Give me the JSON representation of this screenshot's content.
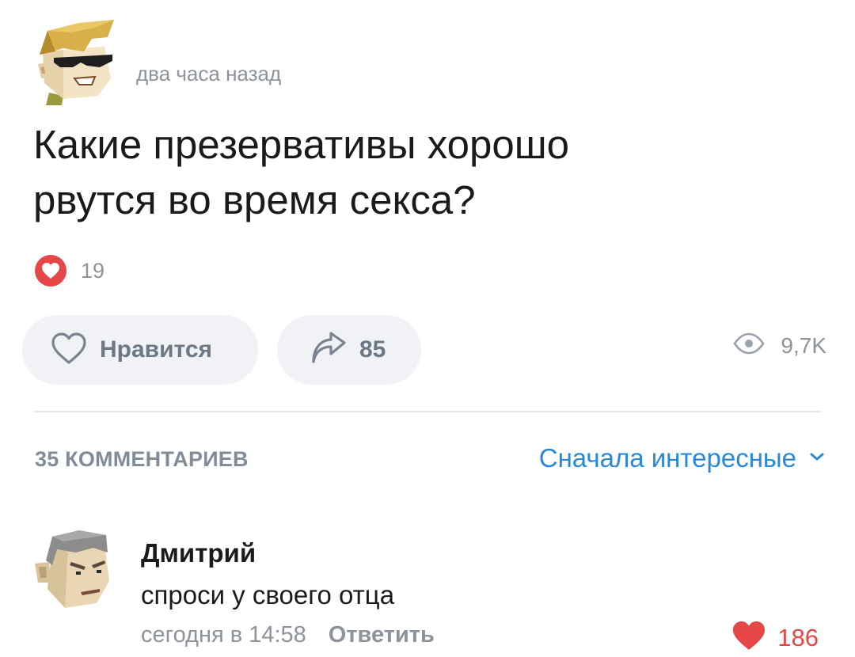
{
  "post": {
    "time": "два часа назад",
    "text_line1": "Какие презервативы хорошо",
    "text_line2": "рвутся во время секса?",
    "reaction_count": "19",
    "like_label": "Нравится",
    "share_count": "85",
    "views": "9,7K"
  },
  "comments_header": {
    "count_label": "35 КОММЕНТАРИЕВ",
    "sort_label": "Сначала интересные"
  },
  "comment": {
    "author": "Дмитрий",
    "text": "спроси у своего отца",
    "time": "сегодня в 14:58",
    "reply_label": "Ответить",
    "likes": "186"
  },
  "colors": {
    "accent_blue": "#2a88d8",
    "like_red": "#e64646",
    "button_bg": "#f0f2f5",
    "secondary_text": "#8d939a"
  },
  "icons": [
    "avatar-sunglasses",
    "heart-icon",
    "share-arrow-icon",
    "eye-icon",
    "chevron-down-icon",
    "avatar-angry"
  ]
}
